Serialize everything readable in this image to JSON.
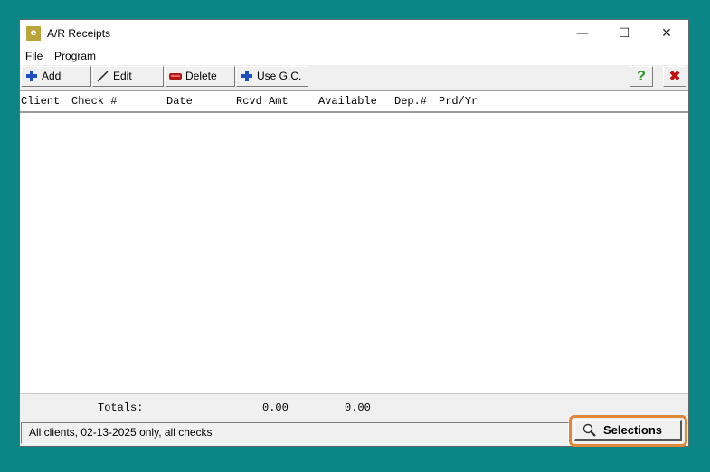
{
  "window": {
    "title": "A/R Receipts",
    "app_icon_text": "e",
    "minimize_symbol": "—",
    "maximize_symbol": "☐",
    "close_symbol": "✕"
  },
  "menu": {
    "items": [
      "File",
      "Program"
    ]
  },
  "toolbar": {
    "add_label": "Add",
    "edit_label": "Edit",
    "delete_label": "Delete",
    "use_gc_label": "Use G.C.",
    "help_symbol": "?",
    "exit_symbol": "✖"
  },
  "list": {
    "columns": [
      "Client",
      "Check #",
      "Date",
      "Rcvd Amt",
      "Available",
      "Dep.#",
      "Prd/Yr"
    ],
    "rows": []
  },
  "totals": {
    "label": "Totals:",
    "rcvd_amt": "0.00",
    "available": "0.00"
  },
  "status": {
    "text": "All clients, 02-13-2025 only, all checks"
  },
  "selections": {
    "label": "Selections"
  },
  "colors": {
    "desktop": "#0b8585",
    "highlight": "#e0883a",
    "add_icon": "#1f4fbf",
    "delete_icon": "#b01818",
    "help_icon": "#1a9a1a",
    "exit_icon": "#c01010"
  }
}
